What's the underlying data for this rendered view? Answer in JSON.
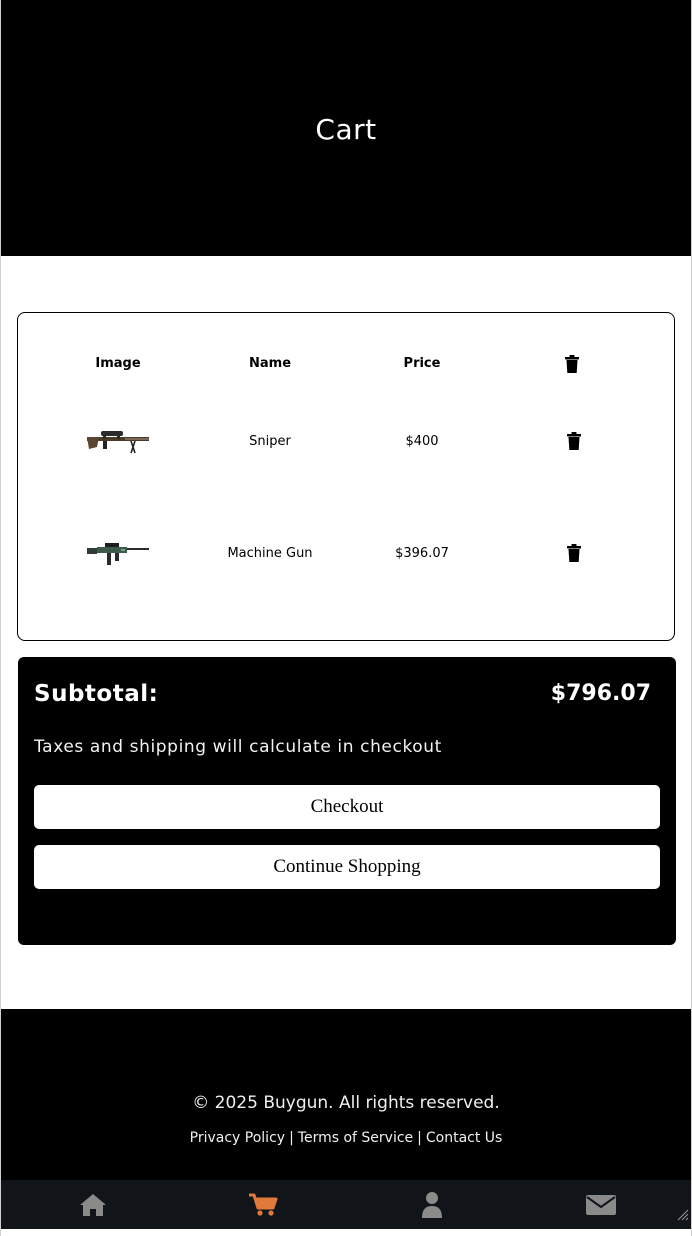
{
  "header": {
    "title": "Cart"
  },
  "cart": {
    "columns": {
      "image": "Image",
      "name": "Name",
      "price": "Price",
      "remove_icon": "trash-icon"
    },
    "items": [
      {
        "image_icon": "sniper-rifle-image",
        "name": "Sniper",
        "price": "$400"
      },
      {
        "image_icon": "machine-gun-image",
        "name": "Machine Gun",
        "price": "$396.07"
      }
    ]
  },
  "summary": {
    "subtotal_label": "Subtotal:",
    "subtotal_value": "$796.07",
    "note": "Taxes and shipping will calculate in checkout",
    "checkout_label": "Checkout",
    "continue_label": "Continue Shopping"
  },
  "footer": {
    "copyright": "© 2025 Buygun. All rights reserved.",
    "links": [
      "Privacy Policy",
      "Terms of Service",
      "Contact Us"
    ],
    "separator": "|"
  },
  "bottom_nav": {
    "items": [
      {
        "icon": "home-icon",
        "active": false
      },
      {
        "icon": "cart-icon",
        "active": true
      },
      {
        "icon": "user-icon",
        "active": false
      },
      {
        "icon": "mail-icon",
        "active": false
      }
    ],
    "active_color": "#e07a3a",
    "inactive_color": "#8a8a8a"
  },
  "colors": {
    "header_bg": "#000000",
    "summary_bg": "#000000",
    "footer_bg": "#000000",
    "nav_bg": "#111418"
  }
}
